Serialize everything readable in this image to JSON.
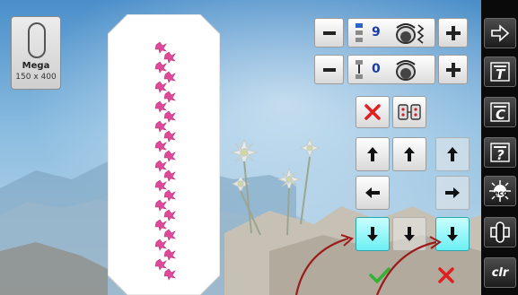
{
  "hoop": {
    "name": "Mega",
    "size": "150 x 400",
    "icon": "hoop-icon"
  },
  "tension": {
    "top": {
      "value": "9",
      "minus": "−",
      "plus": "+"
    },
    "bottom": {
      "value": "0",
      "minus": "−",
      "plus": "+"
    }
  },
  "sidebar": {
    "items": [
      {
        "icon": "arrow-right-icon"
      },
      {
        "icon": "text-t-icon",
        "label": "T"
      },
      {
        "icon": "text-c-icon",
        "label": "C"
      },
      {
        "icon": "help-icon",
        "label": "?"
      },
      {
        "icon": "eco-icon",
        "label": "eco"
      },
      {
        "icon": "hoop-position-icon"
      },
      {
        "icon": "clear-icon",
        "label": "clr"
      }
    ]
  },
  "colors": {
    "accent_cyan": "#6cf0f3",
    "cancel_red": "#e02020",
    "confirm_green": "#33b233",
    "annotation": "#9c1c1c"
  }
}
